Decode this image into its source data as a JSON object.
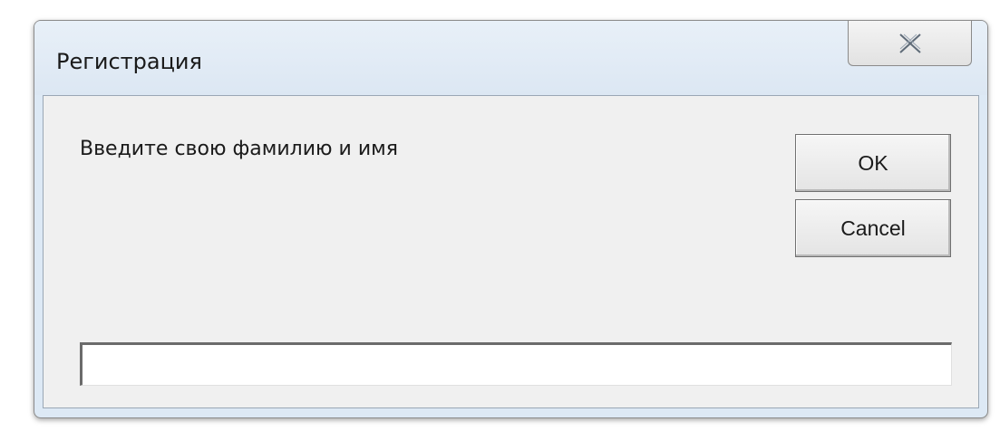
{
  "window": {
    "title": "Регистрация",
    "close_icon": "close-icon"
  },
  "dialog": {
    "prompt": "Введите свою фамилию и имя",
    "ok_label": "OK",
    "cancel_label": "Cancel",
    "input_value": ""
  },
  "colors": {
    "titlebar": "#dde9f5",
    "client_background": "#f0f0f0",
    "input_background": "#ffffff"
  }
}
